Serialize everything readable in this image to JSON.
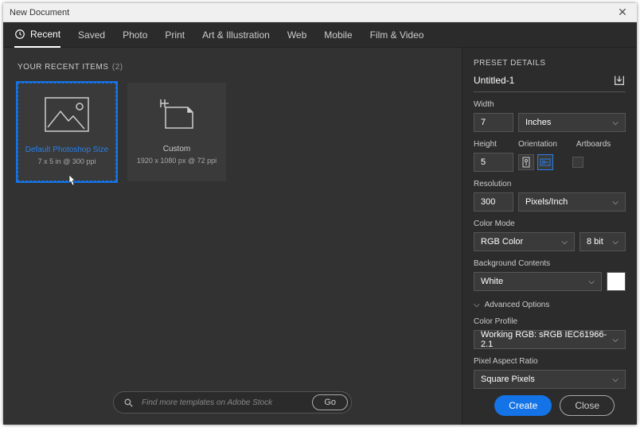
{
  "window": {
    "title": "New Document"
  },
  "tabs": {
    "items": [
      {
        "label": "Recent",
        "active": true
      },
      {
        "label": "Saved"
      },
      {
        "label": "Photo"
      },
      {
        "label": "Print"
      },
      {
        "label": "Art & Illustration"
      },
      {
        "label": "Web"
      },
      {
        "label": "Mobile"
      },
      {
        "label": "Film & Video"
      }
    ]
  },
  "recent": {
    "section_label": "YOUR RECENT ITEMS",
    "count": "(2)",
    "presets": [
      {
        "name": "Default Photoshop Size",
        "detail": "7 x 5 in @ 300 ppi",
        "selected": true,
        "thumb": "image"
      },
      {
        "name": "Custom",
        "detail": "1920 x 1080 px @ 72 ppi",
        "selected": false,
        "thumb": "custom"
      }
    ]
  },
  "search": {
    "placeholder": "Find more templates on Adobe Stock",
    "go_label": "Go"
  },
  "details": {
    "header": "PRESET DETAILS",
    "doc_name": "Untitled-1",
    "width_label": "Width",
    "width_value": "7",
    "width_unit": "Inches",
    "height_label": "Height",
    "height_value": "5",
    "orientation_label": "Orientation",
    "artboards_label": "Artboards",
    "orientation": "landscape",
    "artboards_checked": false,
    "resolution_label": "Resolution",
    "resolution_value": "300",
    "resolution_unit": "Pixels/Inch",
    "color_mode_label": "Color Mode",
    "color_mode": "RGB Color",
    "bit_depth": "8 bit",
    "bg_label": "Background Contents",
    "bg_value": "White",
    "bg_color": "#ffffff",
    "advanced_label": "Advanced Options",
    "color_profile_label": "Color Profile",
    "color_profile": "Working RGB: sRGB IEC61966-2.1",
    "pixel_aspect_label": "Pixel Aspect Ratio",
    "pixel_aspect": "Square Pixels"
  },
  "footer": {
    "create_label": "Create",
    "close_label": "Close"
  }
}
